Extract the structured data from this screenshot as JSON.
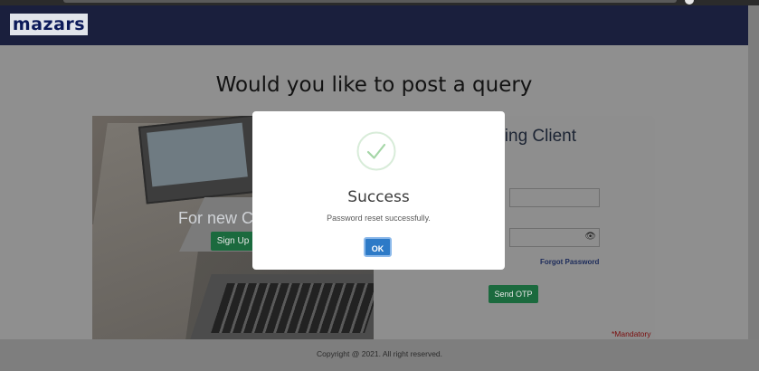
{
  "header": {
    "logo_text": "mazars"
  },
  "main": {
    "title": "Would you like to post a query",
    "new_client": {
      "title": "For new C",
      "signup_label": "Sign Up"
    },
    "existing_client": {
      "title": "sting Client",
      "forgot_password_label": "Forgot Password",
      "send_otp_label": "Send OTP",
      "mandatory_note": "*Mandatory"
    }
  },
  "modal": {
    "title": "Success",
    "message": "Password reset successfully.",
    "ok_label": "OK",
    "icon": "check-icon",
    "colors": {
      "accent": "#2d7ac7",
      "check": "#a5d6a7"
    }
  },
  "footer": {
    "copyright": "Copyright @ 2021. All right reserved."
  },
  "colors": {
    "header_bg": "#1a1f3d",
    "button_green": "#1b6a3e",
    "brand_blue": "#0c1a59"
  }
}
